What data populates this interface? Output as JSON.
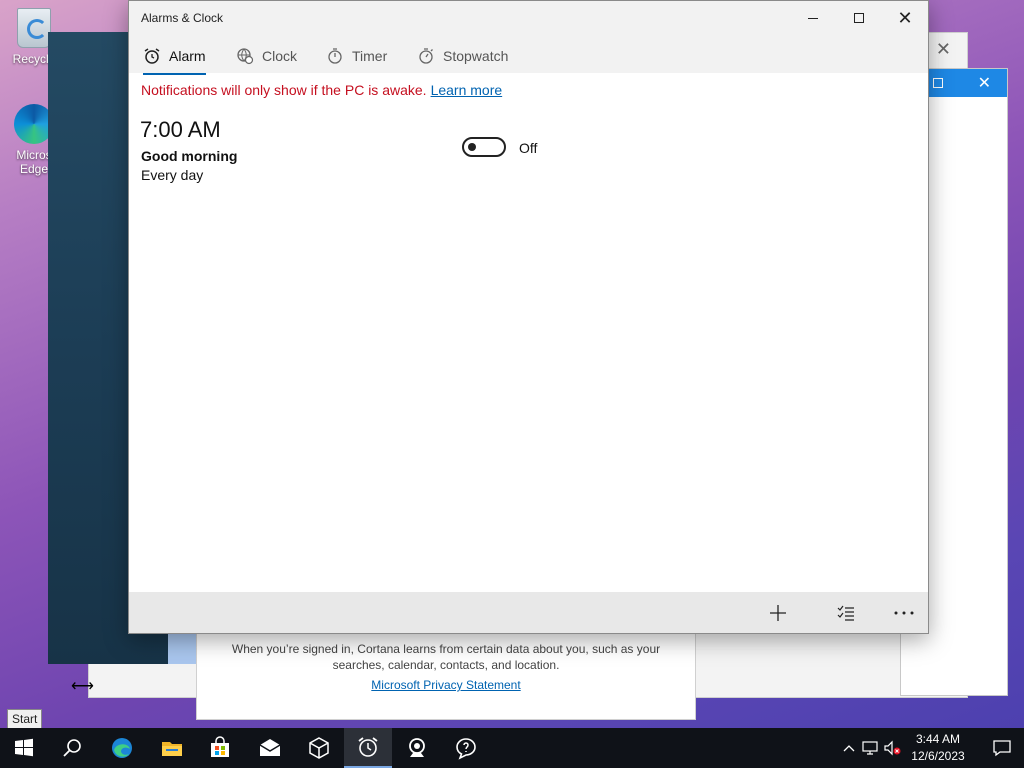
{
  "desktop": {
    "icons": [
      {
        "label": "Recycle Bin",
        "visible_label": "Recycle"
      },
      {
        "label": "Microsoft Edge",
        "visible_label": "Micros Edge"
      }
    ],
    "start_tooltip": "Start"
  },
  "background": {
    "cortana": {
      "text": "When you’re signed in, Cortana learns from certain data about you, such as your searches, calendar, contacts, and location.",
      "link": "Microsoft Privacy Statement"
    }
  },
  "app": {
    "title": "Alarms & Clock",
    "tabs": [
      {
        "label": "Alarm",
        "icon": "alarm-clock-icon",
        "active": true
      },
      {
        "label": "Clock",
        "icon": "world-clock-icon",
        "active": false
      },
      {
        "label": "Timer",
        "icon": "timer-icon",
        "active": false
      },
      {
        "label": "Stopwatch",
        "icon": "stopwatch-icon",
        "active": false
      }
    ],
    "notice": {
      "text": "Notifications will only show if the PC is awake.",
      "link": "Learn more"
    },
    "alarms": [
      {
        "time": "7:00 AM",
        "name": "Good morning",
        "repeat": "Every day",
        "enabled": false,
        "state_label": "Off"
      }
    ],
    "commands": {
      "add": "plus-icon",
      "select": "select-list-icon",
      "more": "more-icon"
    },
    "accent": "#0063b1",
    "notice_color": "#c50f1f"
  },
  "taskbar": {
    "items": [
      "start-icon",
      "search-icon",
      "edge-icon",
      "file-explorer-icon",
      "store-icon",
      "mail-icon",
      "3d-viewer-icon",
      "alarms-clock-icon",
      "camera-icon",
      "feedback-hub-icon"
    ],
    "time": "3:44 AM",
    "date": "12/6/2023"
  }
}
